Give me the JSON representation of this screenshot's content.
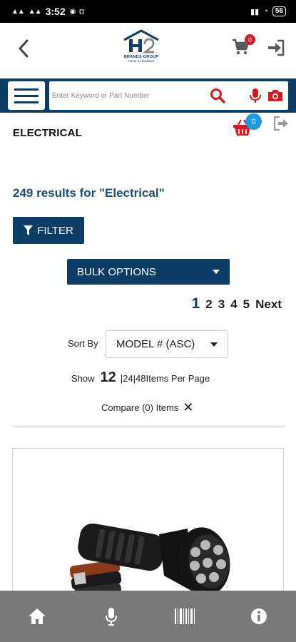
{
  "status_bar": {
    "time": "3:52",
    "left_icons": [
      "signal-icon",
      "signal-icon",
      "messenger-icon",
      "notification-icon"
    ],
    "battery": "56"
  },
  "header": {
    "logo_name": "BRANDS GROUP",
    "logo_sub": "Home & Hardware",
    "cart_count": "0"
  },
  "search": {
    "placeholder": "Enter Keyword or Part Number"
  },
  "category": {
    "title": "ELECTRICAL",
    "basket_count": "0"
  },
  "results": {
    "text": "249 results for \"Electrical\""
  },
  "filter": {
    "label": "FILTER"
  },
  "bulk": {
    "label": "BULK OPTIONS"
  },
  "pagination": {
    "pages": [
      "1",
      "2",
      "3",
      "4",
      "5"
    ],
    "current": "1",
    "next": "Next"
  },
  "sort": {
    "label": "Sort By",
    "selected": "MODEL # (ASC)"
  },
  "per_page": {
    "prefix": "Show",
    "current": "12",
    "sep1": " | ",
    "opt24": "24",
    "sep2": " | ",
    "opt48": "48",
    "suffix": " Items Per Page"
  },
  "compare": {
    "text": "Compare (0) Items"
  },
  "bottom_nav": [
    "home-icon",
    "microphone-icon",
    "barcode-icon",
    "info-icon"
  ],
  "colors": {
    "primary": "#0c3d66",
    "accent_red": "#d71920",
    "badge_blue": "#1e9be0",
    "nav_gray": "#7a7a7a"
  }
}
